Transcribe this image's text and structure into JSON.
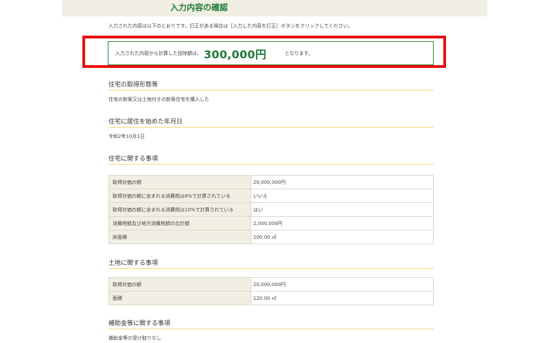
{
  "page": {
    "title": "入力内容の確認",
    "intro": "入力された内容は以下のとおりです。訂正がある場合は［入力した内容を訂正］ボタンをクリックしてください。"
  },
  "result": {
    "prefix": "入力された内容から計算した控除額は、",
    "amount": "300,000円",
    "suffix": "となります。",
    "highlight_color": "#e8100c",
    "accent_color": "#1f7a34"
  },
  "sections": {
    "acquisition": {
      "heading": "住宅の取得形態等",
      "text": "住宅の新築又は土地付きの新築住宅を購入した"
    },
    "residence": {
      "heading": "住宅に居住を始めた年月日",
      "text": "令和2年10月1日"
    },
    "house": {
      "heading": "住宅に関する事項",
      "rows": [
        {
          "label": "取得対価の額",
          "value": "20,000,000円"
        },
        {
          "label": "取得対価の額に含まれる消費税は8%で計算されている",
          "value": "いいえ"
        },
        {
          "label": "取得対価の額に含まれる消費税は10%で計算されている",
          "value": "はい"
        },
        {
          "label": "消費税額及び地方消費税額の合計額",
          "value": "2,000,000円"
        },
        {
          "label": "床面積",
          "value": "100.00 ㎡"
        }
      ]
    },
    "land": {
      "heading": "土地に関する事項",
      "rows": [
        {
          "label": "取得対価の額",
          "value": "20,000,000円"
        },
        {
          "label": "面積",
          "value": "120.00 ㎡"
        }
      ]
    },
    "subsidy": {
      "heading": "補助金等に関する事項",
      "text": "補助金等の受け取りなし"
    }
  }
}
